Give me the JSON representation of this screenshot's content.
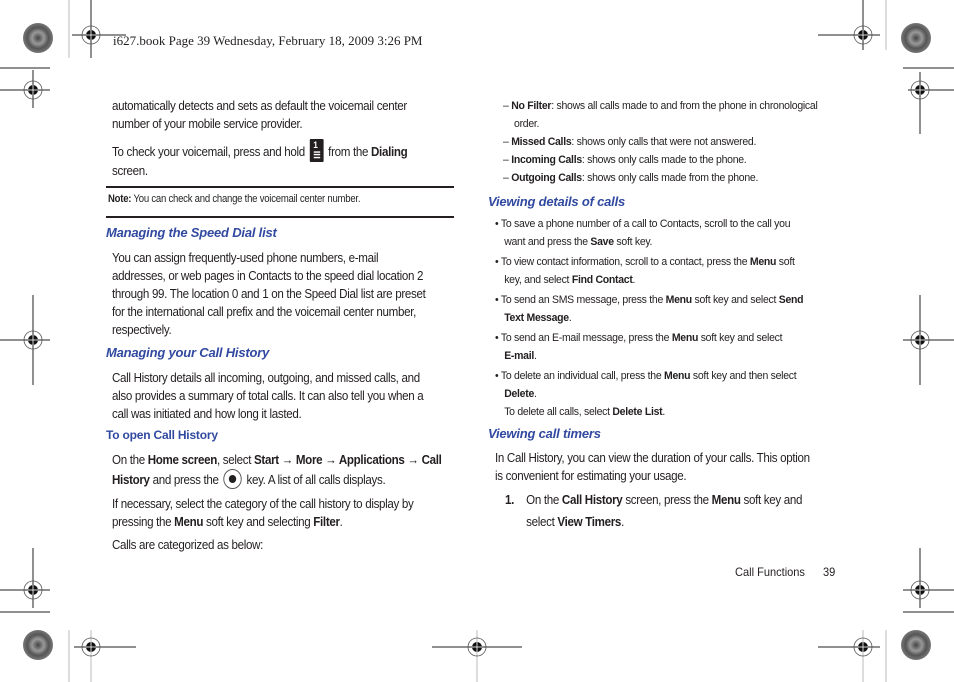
{
  "header": {
    "slug": "i627.book  Page 39  Wednesday, February 18, 2009  3:26 PM"
  },
  "left_column": {
    "intro_line1": "automatically detects and sets as default the voicemail center",
    "intro_line2": "number of your mobile service provider.",
    "voicemail": {
      "pre": "To check your voicemail, press and hold",
      "key_icon": "key-1-voicemail-icon",
      "mid": "from the",
      "bold": "Dialing",
      "post": "screen."
    },
    "note": {
      "label": "Note:",
      "text": "You can check and change the voicemail center number."
    },
    "speed_dial": {
      "heading": "Managing the Speed Dial list",
      "lines": [
        "You can assign frequently-used phone numbers, e-mail",
        "addresses, or web pages in Contacts to the speed dial location 2",
        "through 99. The location 0 and 1 on the Speed Dial list are preset",
        "for the international call prefix and the voicemail center number,",
        "respectively."
      ]
    },
    "call_history": {
      "heading": "Managing your Call History",
      "lines": [
        "Call History details all incoming, outgoing, and missed calls, and",
        "also provides a summary of total calls. It can also tell you when a",
        "call was initiated and how long it lasted."
      ]
    },
    "open_history": {
      "heading": "To open Call History",
      "l1_pre": "On the ",
      "l1_b1": "Home screen",
      "l1_mid": ", select ",
      "l1_b2": "Start → More → Applications → Call",
      "l2_b": "History",
      "l2_pre": " and press the ",
      "ok_icon": "ok-key-icon",
      "l2_post": " key. A list of all calls displays.",
      "filter_l1": "If necessary, select the category of the call history to display by",
      "filter_pre": "pressing the ",
      "filter_b1": "Menu",
      "filter_mid": " soft key and selecting ",
      "filter_b2": "Filter",
      "filter_end": ".",
      "categorized": "Calls are categorized as below:"
    }
  },
  "right_column": {
    "filters": [
      {
        "name": "No Filter",
        "desc": ": shows all calls made to and from the phone in chronological",
        "cont": "order."
      },
      {
        "name": "Missed Calls",
        "desc": ": shows only calls that were not answered."
      },
      {
        "name": "Incoming Calls",
        "desc": ": shows only calls made to the phone."
      },
      {
        "name": "Outgoing Calls",
        "desc": ": shows only calls made from the phone."
      }
    ],
    "details": {
      "heading": "Viewing details of calls",
      "b1_l1": "To save a phone number of a call to Contacts, scroll to the call you",
      "b1_l2_pre": "want and press the ",
      "b1_l2_b": "Save",
      "b1_l2_post": " soft key.",
      "b2_l1_pre": "To view contact information, scroll to a contact, press the ",
      "b2_l1_b": "Menu",
      "b2_l1_post": " soft",
      "b2_l2_pre": "key, and select ",
      "b2_l2_b": "Find Contact",
      "b2_l2_post": ".",
      "b3_l1_pre": "To send an SMS message, press the ",
      "b3_l1_b": "Menu",
      "b3_l1_mid": " soft key and select ",
      "b3_l1_b2": "Send",
      "b3_l2_b": "Text Message",
      "b3_l2_post": ".",
      "b4_l1_pre": "To send an E-mail message, press the ",
      "b4_l1_b": "Menu",
      "b4_l1_post": " soft key and select",
      "b4_l2_b": "E-mail",
      "b4_l2_post": ".",
      "b5_l1_pre": "To delete an individual call, press the ",
      "b5_l1_b": "Menu",
      "b5_l1_post": " soft key and then select",
      "b5_l2_b": "Delete",
      "b5_l2_post": ".",
      "b5_l3_pre": "To delete all calls, select ",
      "b5_l3_b": "Delete List",
      "b5_l3_post": "."
    },
    "timers": {
      "heading": "Viewing call timers",
      "l1": "In Call History, you can view the duration of your calls. This option",
      "l2": "is convenient for estimating your usage.",
      "step_num": "1.",
      "s1_pre": "On the ",
      "s1_b1": "Call History",
      "s1_mid": " screen, press the ",
      "s1_b2": "Menu",
      "s1_post": " soft key and",
      "s2_pre": "select ",
      "s2_b": "View Timers",
      "s2_post": "."
    }
  },
  "footer": {
    "section": "Call Functions",
    "page": "39"
  },
  "bullet_char": "•",
  "dash_char": "–"
}
